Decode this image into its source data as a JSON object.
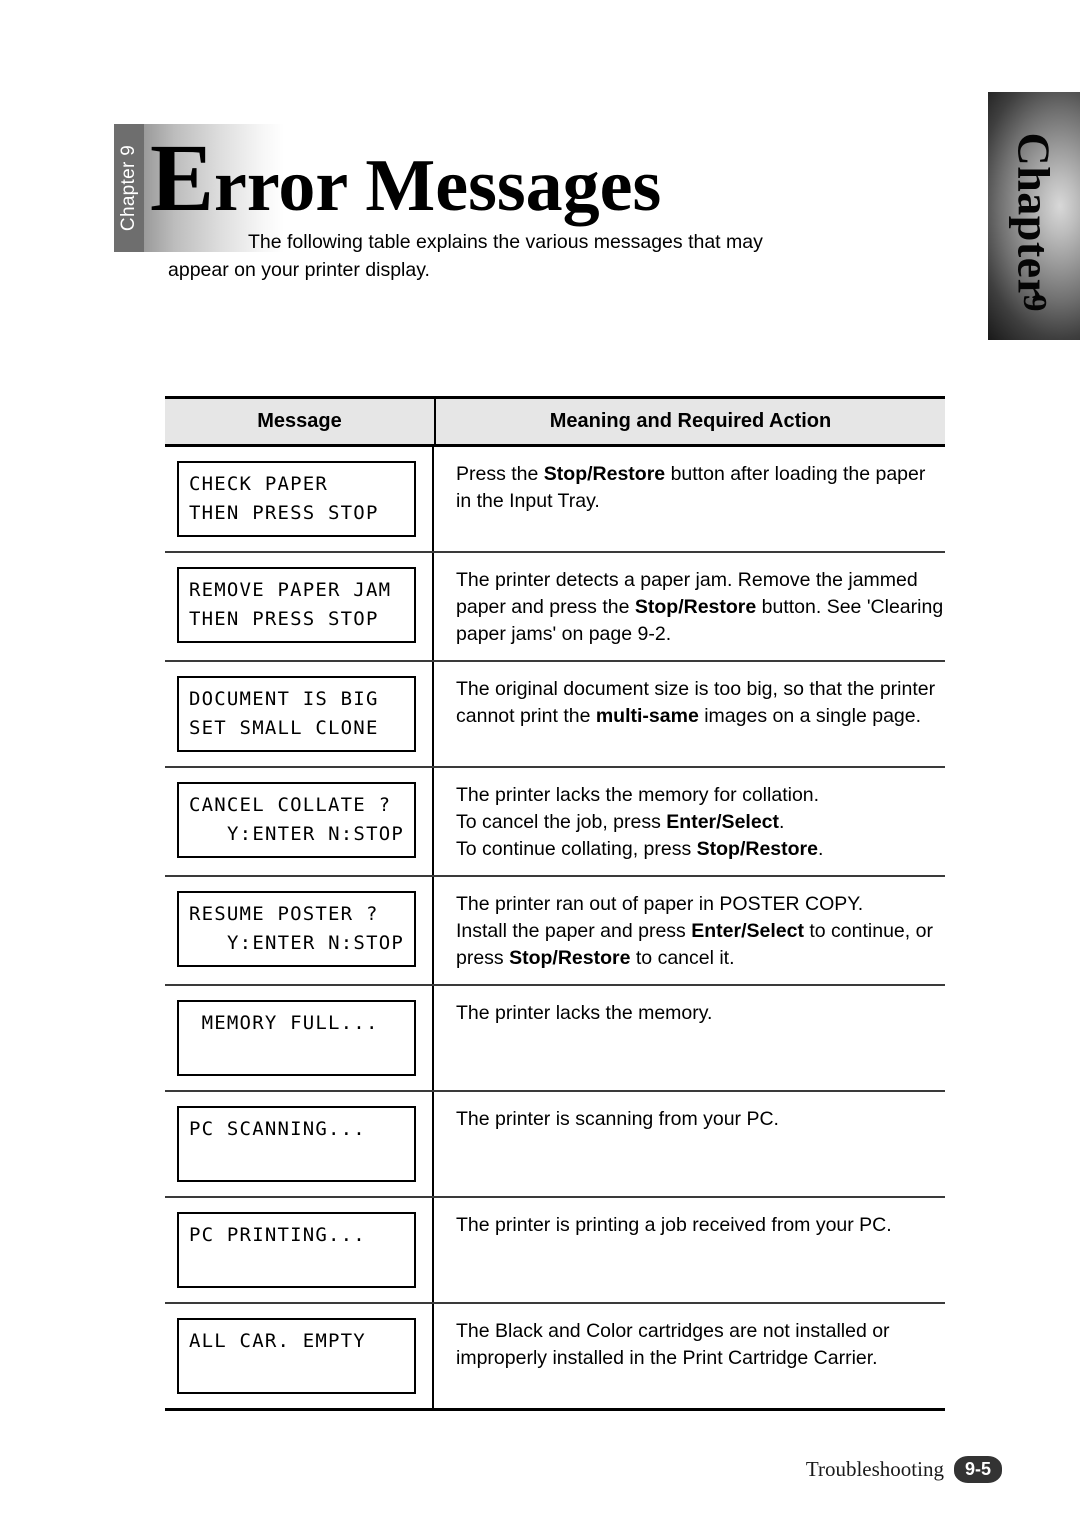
{
  "chapter_tab": {
    "label": "Chapter",
    "number": "9"
  },
  "header": {
    "vertical_label": "Chapter 9",
    "title_cap": "E",
    "title_rest": "rror Messages",
    "intro": "The following table explains the various messages that may appear on your printer display."
  },
  "table": {
    "columns": {
      "message": "Message",
      "meaning": "Meaning and Required Action"
    },
    "rows": [
      {
        "lcd_line1": "CHECK PAPER",
        "lcd_line2": "THEN PRESS STOP",
        "lcd_line2_align": "left",
        "meaning_parts": [
          {
            "t": "Press the ",
            "b": false
          },
          {
            "t": "Stop/Restore",
            "b": true
          },
          {
            "t": " button after loading the paper in the Input Tray.",
            "b": false
          }
        ]
      },
      {
        "lcd_line1": "REMOVE PAPER JAM",
        "lcd_line2": "THEN PRESS STOP",
        "lcd_line2_align": "left",
        "meaning_parts": [
          {
            "t": "The printer detects a paper jam. Remove the jammed paper and press the ",
            "b": false
          },
          {
            "t": "Stop/Restore",
            "b": true
          },
          {
            "t": " button. See 'Clearing paper jams' on page 9-2.",
            "b": false
          }
        ]
      },
      {
        "lcd_line1": "DOCUMENT IS BIG",
        "lcd_line2": "SET SMALL CLONE",
        "lcd_line2_align": "left",
        "meaning_parts": [
          {
            "t": "The original document size is too big, so that the printer cannot print the ",
            "b": false
          },
          {
            "t": "multi-same",
            "b": true
          },
          {
            "t": " images on a single page.",
            "b": false
          }
        ]
      },
      {
        "lcd_line1": "CANCEL COLLATE ?",
        "lcd_line2": "Y:ENTER N:STOP",
        "lcd_line2_align": "right",
        "meaning_parts": [
          {
            "t": "The printer lacks the memory for collation.\nTo cancel the job, press ",
            "b": false
          },
          {
            "t": "Enter/Select",
            "b": true
          },
          {
            "t": ".\nTo continue collating, press ",
            "b": false
          },
          {
            "t": "Stop/Restore",
            "b": true
          },
          {
            "t": ".",
            "b": false
          }
        ]
      },
      {
        "lcd_line1": "RESUME POSTER ?",
        "lcd_line2": "Y:ENTER N:STOP",
        "lcd_line2_align": "right",
        "meaning_parts": [
          {
            "t": "The printer ran out of paper in POSTER COPY.\nInstall the paper and press ",
            "b": false
          },
          {
            "t": "Enter/Select",
            "b": true
          },
          {
            "t": " to continue, or press ",
            "b": false
          },
          {
            "t": "Stop/Restore",
            "b": true
          },
          {
            "t": " to cancel it.",
            "b": false
          }
        ]
      },
      {
        "lcd_line1": " MEMORY FULL...",
        "lcd_line2": "",
        "lcd_line2_align": "left",
        "meaning_parts": [
          {
            "t": "The printer lacks the memory.",
            "b": false
          }
        ]
      },
      {
        "lcd_line1": "PC SCANNING...",
        "lcd_line2": "",
        "lcd_line2_align": "left",
        "meaning_parts": [
          {
            "t": "The printer is scanning from your PC.",
            "b": false
          }
        ]
      },
      {
        "lcd_line1": "PC PRINTING...",
        "lcd_line2": "",
        "lcd_line2_align": "left",
        "meaning_parts": [
          {
            "t": "The printer is printing a job received from your PC.",
            "b": false
          }
        ]
      },
      {
        "lcd_line1": "ALL CAR. EMPTY",
        "lcd_line2": "",
        "lcd_line2_align": "left",
        "meaning_parts": [
          {
            "t": "The Black and Color cartridges are not installed or improperly installed in the Print Cartridge Carrier.",
            "b": false
          }
        ]
      }
    ]
  },
  "footer": {
    "section": "Troubleshooting",
    "page": "9-5"
  },
  "colors": {
    "header_fill": "#e6e6e6",
    "tab_band": "#6e6e6e",
    "badge": "#333333"
  }
}
